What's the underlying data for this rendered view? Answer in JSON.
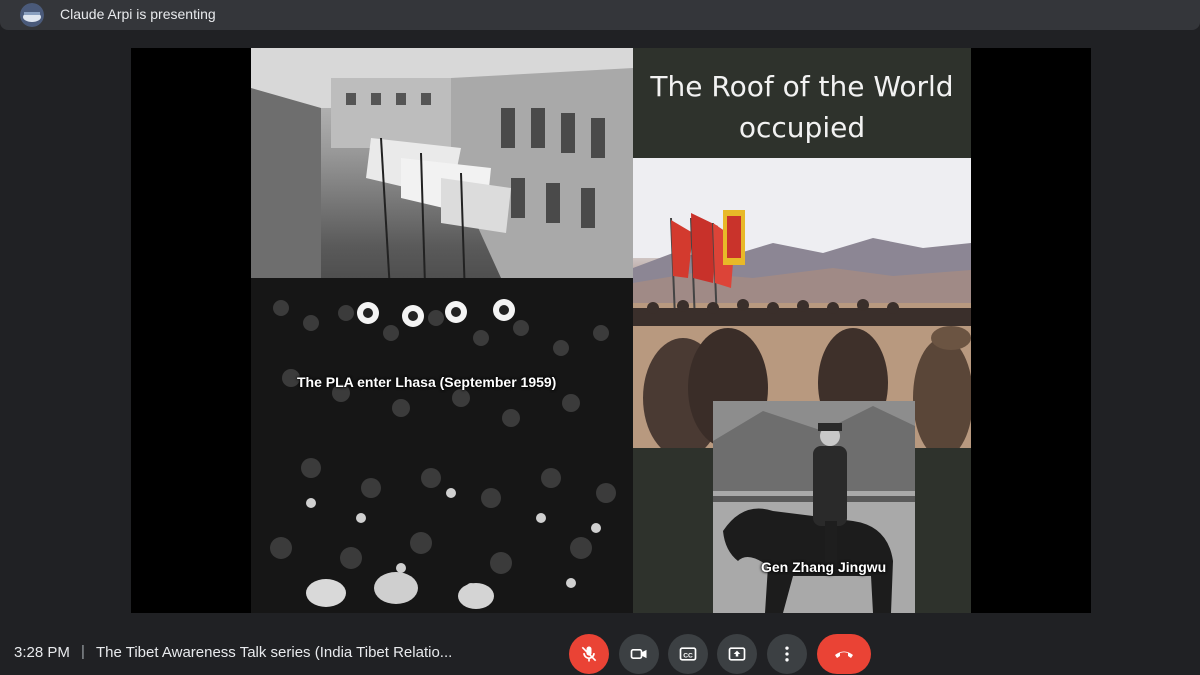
{
  "presenter_bar": {
    "text": "Claude Arpi is presenting"
  },
  "slide": {
    "title": "The Roof  of the World occupied",
    "caption_left": "The PLA enter Lhasa (September 1959)",
    "caption_right": "Gen Zhang Jingwu"
  },
  "bottom_bar": {
    "time": "3:28 PM",
    "separator": "|",
    "meeting_title": "The Tibet Awareness Talk series (India Tibet Relatio..."
  },
  "controls": [
    {
      "name": "microphone-muted",
      "icon": "mic-off-icon",
      "color": "#ea4335"
    },
    {
      "name": "camera",
      "icon": "videocam-icon"
    },
    {
      "name": "captions",
      "icon": "cc-icon"
    },
    {
      "name": "present",
      "icon": "present-to-all-icon"
    },
    {
      "name": "more-options",
      "icon": "more-vert-icon"
    },
    {
      "name": "leave-call",
      "icon": "call-end-icon",
      "color": "#ea4335"
    }
  ],
  "colors": {
    "background": "#202124",
    "top_bar": "#34363a",
    "slide_panel": "#2e322c",
    "control": "#3c4043",
    "danger": "#ea4335"
  }
}
